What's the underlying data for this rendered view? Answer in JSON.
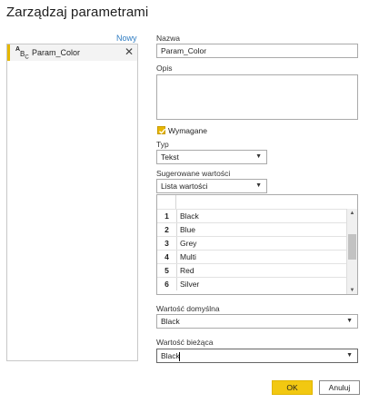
{
  "dialog": {
    "title": "Zarządzaj parametrami"
  },
  "left": {
    "new_link": "Nowy",
    "items": [
      {
        "label": "Param_Color",
        "icon": "abc-type-icon"
      }
    ]
  },
  "form": {
    "name_label": "Nazwa",
    "name_value": "Param_Color",
    "description_label": "Opis",
    "description_value": "",
    "required_label": "Wymagane",
    "required_checked": true,
    "type_label": "Typ",
    "type_value": "Tekst",
    "suggested_label": "Sugerowane wartości",
    "suggested_value": "Lista wartości",
    "values": [
      {
        "num": "1",
        "value": "Black"
      },
      {
        "num": "2",
        "value": "Blue"
      },
      {
        "num": "3",
        "value": "Grey"
      },
      {
        "num": "4",
        "value": "Multi"
      },
      {
        "num": "5",
        "value": "Red"
      },
      {
        "num": "6",
        "value": "Silver"
      }
    ],
    "default_label": "Wartość domyślna",
    "default_value": "Black",
    "current_label": "Wartość bieżąca",
    "current_value": "Black"
  },
  "buttons": {
    "ok": "OK",
    "cancel": "Anuluj"
  },
  "colors": {
    "accent": "#f2c811",
    "link": "#2f7cc2",
    "selected_row": "#f3f3f3"
  }
}
